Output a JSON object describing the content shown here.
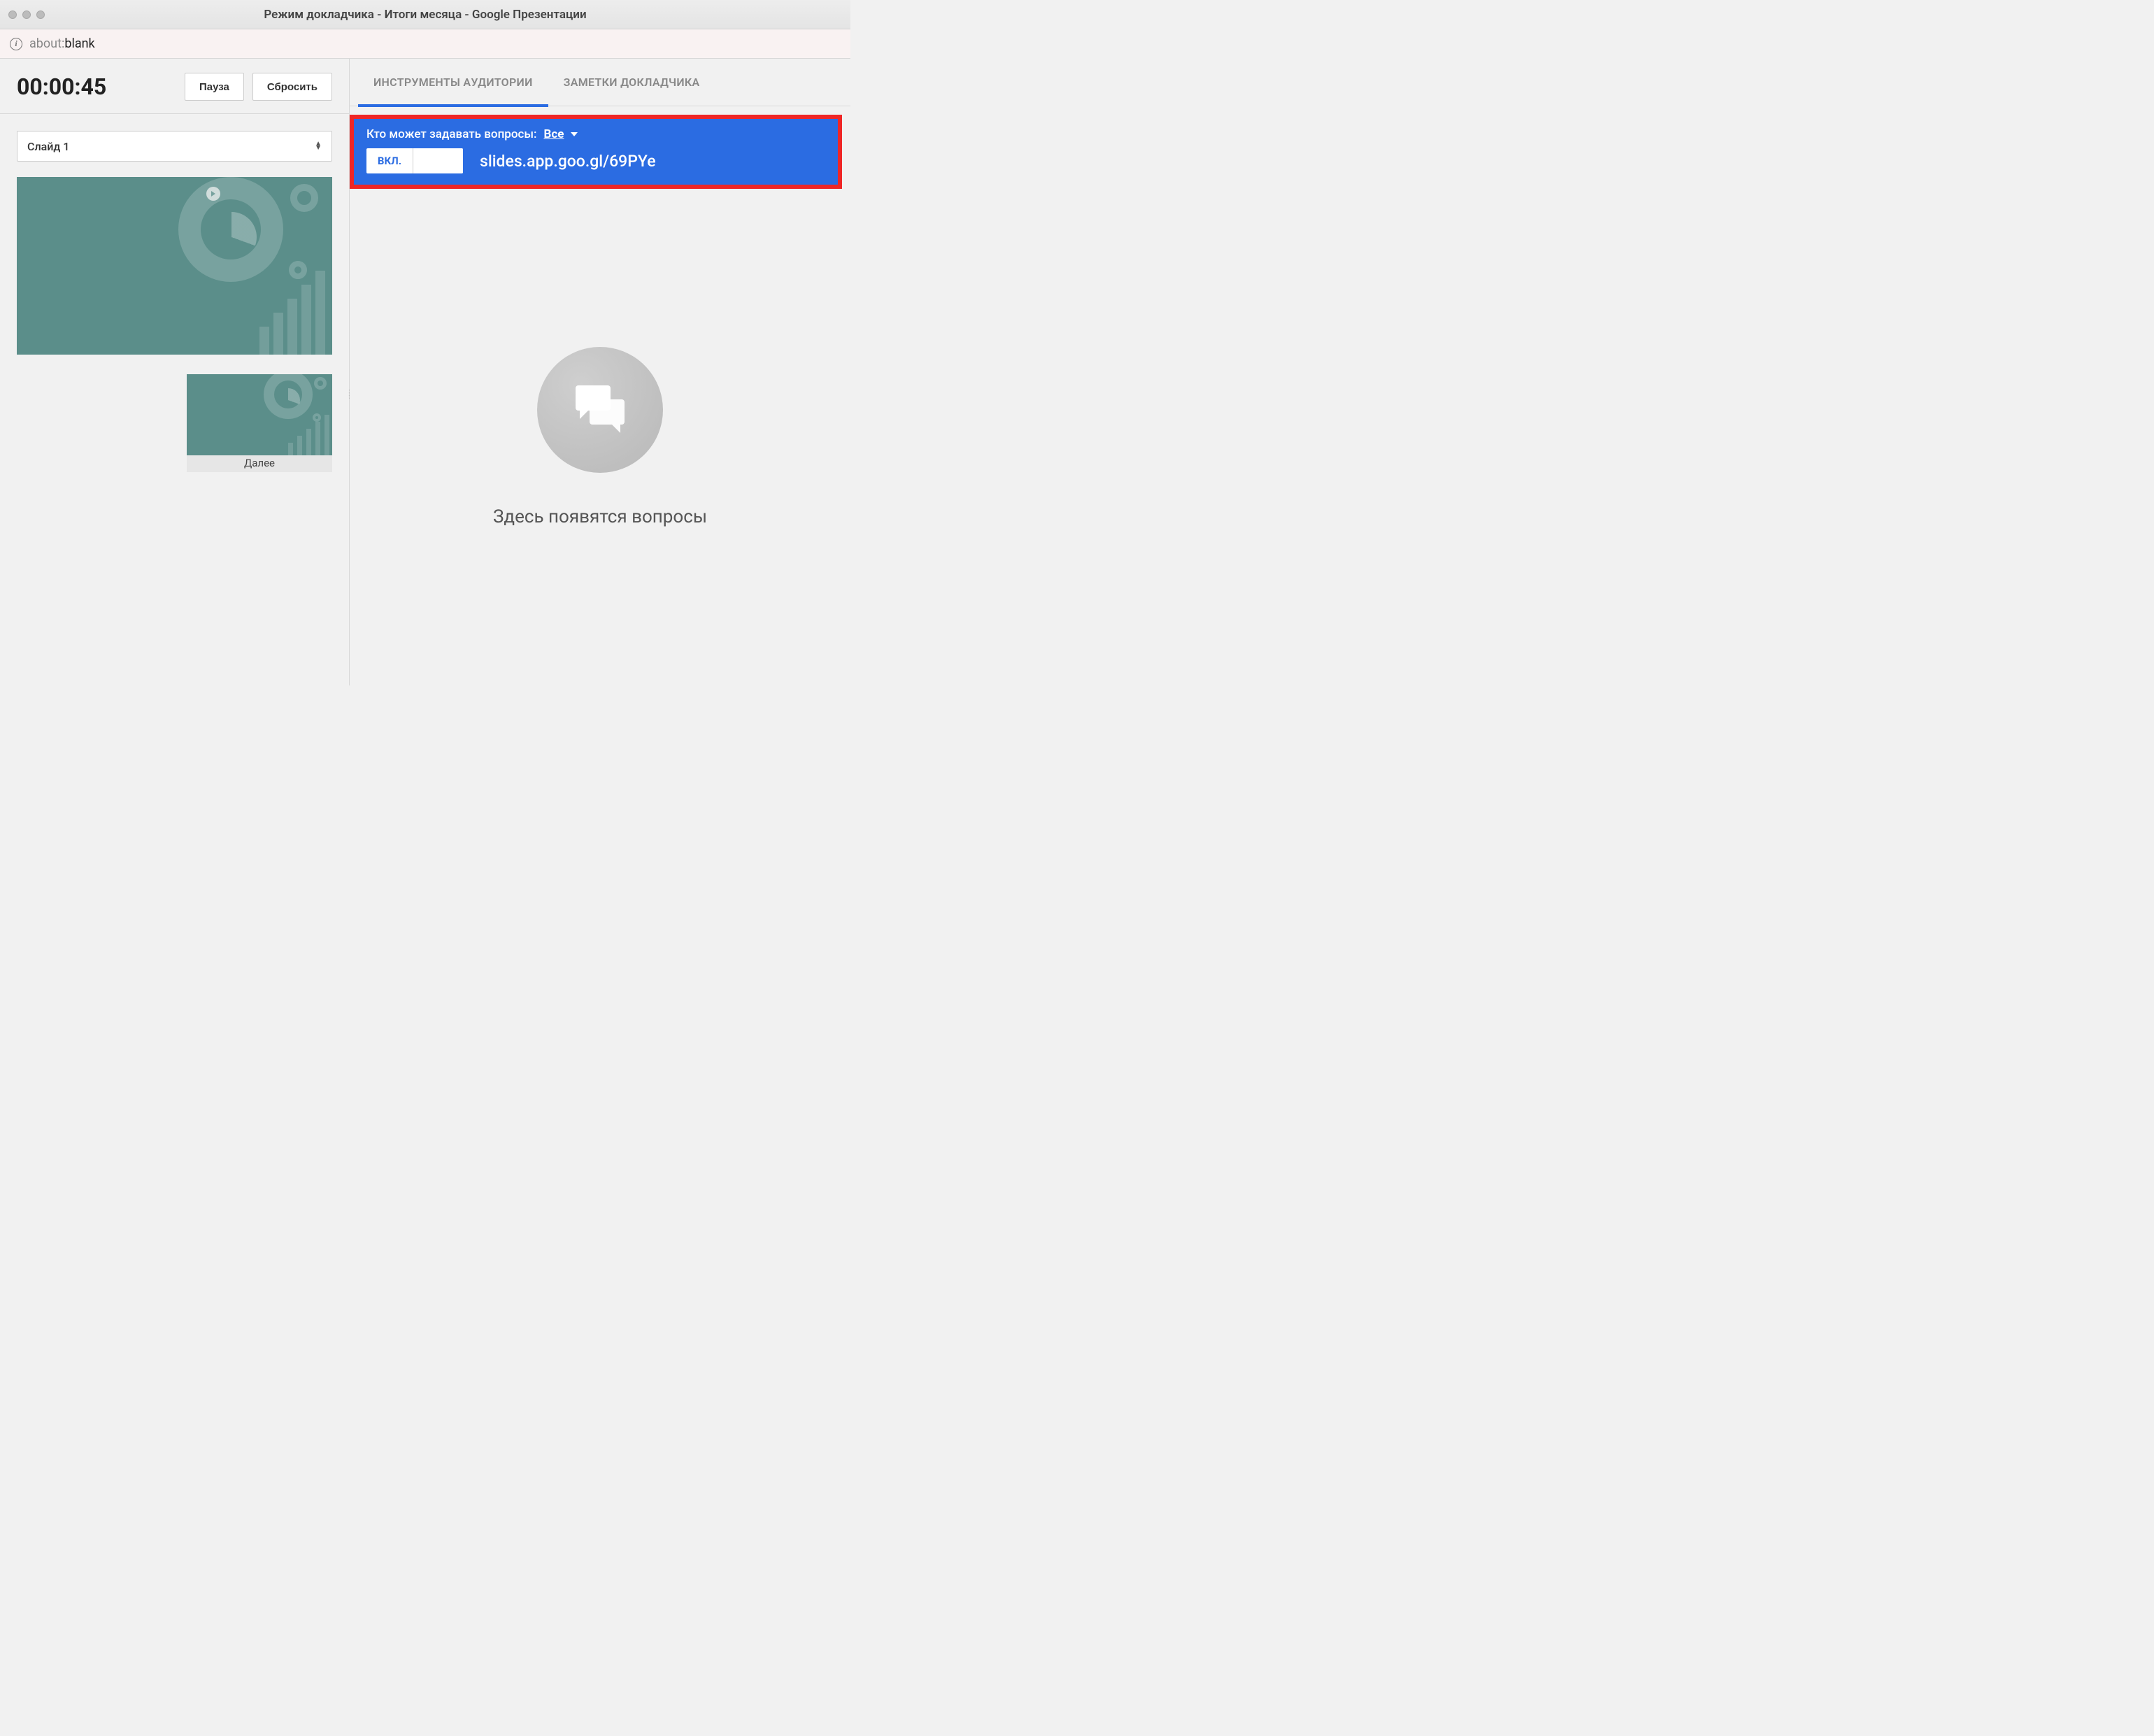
{
  "window": {
    "title": "Режим докладчика - Итоги месяца - Google Презентации"
  },
  "address": {
    "protocol": "about:",
    "path": "blank"
  },
  "timer": {
    "value": "00:00:45",
    "pause_label": "Пауза",
    "reset_label": "Сбросить"
  },
  "slide_select": {
    "label": "Слайд 1"
  },
  "next": {
    "label": "Далее"
  },
  "tabs": {
    "audience": "ИНСТРУМЕНТЫ АУДИТОРИИ",
    "notes": "ЗАМЕТКИ ДОКЛАДЧИКА"
  },
  "qa": {
    "who_label": "Кто может задавать вопросы:",
    "who_value": "Все",
    "toggle_on": "ВКЛ.",
    "url": "slides.app.goo.gl/69PYe"
  },
  "placeholder": {
    "text": "Здесь появятся вопросы"
  }
}
